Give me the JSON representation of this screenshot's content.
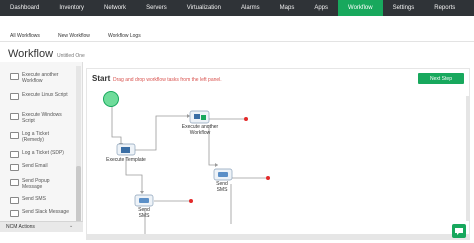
{
  "topnav": {
    "items": [
      "Dashboard",
      "Inventory",
      "Network",
      "Servers",
      "Virtualization",
      "Alarms",
      "Maps",
      "Apps",
      "Workflow",
      "Settings",
      "Reports"
    ],
    "active": "Workflow"
  },
  "subnav": {
    "items": [
      "All Workflows",
      "New Workflow",
      "Workflow Logs"
    ]
  },
  "page": {
    "title": "Workflow",
    "subtitle": "Untitled One"
  },
  "sidebar": {
    "items": [
      "Execute another Workflow",
      "Execute Linux Script",
      "Execute Windows Script",
      "Log a Ticket (Remedy)",
      "Log a Ticket (SDP)",
      "Send Email",
      "Send Popup Message",
      "Send SMS",
      "Send Slack Message"
    ],
    "footer": "NCM Actions"
  },
  "canvas": {
    "start_label": "Start",
    "hint": "Drag and drop workflow tasks from the left panel.",
    "next_label": "Next Step",
    "nodes": {
      "execute_template": "Execute Template",
      "execute_another": "Execute another Workflow",
      "send_sms_1": "Send SMS",
      "send_sms_2": "Send SMS"
    }
  },
  "colors": {
    "accent": "#18a85d",
    "nav_bg": "#2f3337",
    "hint": "#d9534f",
    "endpoint": "#e32a2a"
  }
}
